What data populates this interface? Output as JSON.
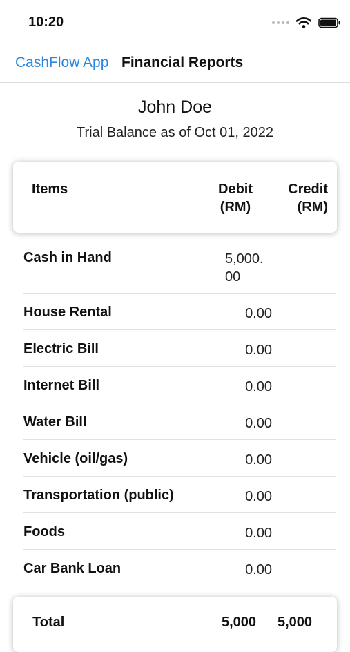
{
  "status_bar": {
    "time": "10:20",
    "icons": [
      "signal-dots-icon",
      "wifi-icon",
      "battery-icon"
    ]
  },
  "nav": {
    "back_label": "CashFlow App",
    "title": "Financial Reports",
    "accent_color": "#2a86e0"
  },
  "report": {
    "owner": "John Doe",
    "subtitle": "Trial Balance as of Oct 01, 2022"
  },
  "table": {
    "headers": {
      "items": "Items",
      "debit_line1": "Debit",
      "debit_line2": "(RM)",
      "credit_line1": "Credit",
      "credit_line2": "(RM)"
    },
    "rows": [
      {
        "label": "Cash in Hand",
        "debit": "5,000.00"
      },
      {
        "label": "House Rental",
        "debit": "0.00"
      },
      {
        "label": "Electric Bill",
        "debit": "0.00"
      },
      {
        "label": "Internet Bill",
        "debit": "0.00"
      },
      {
        "label": "Water Bill",
        "debit": "0.00"
      },
      {
        "label": "Vehicle (oil/gas)",
        "debit": "0.00"
      },
      {
        "label": "Transportation (public)",
        "debit": "0.00"
      },
      {
        "label": "Foods",
        "debit": "0.00"
      },
      {
        "label": "Car Bank Loan",
        "debit": "0.00"
      }
    ],
    "total": {
      "label": "Total",
      "debit": "5,000",
      "credit": "5,000"
    }
  }
}
